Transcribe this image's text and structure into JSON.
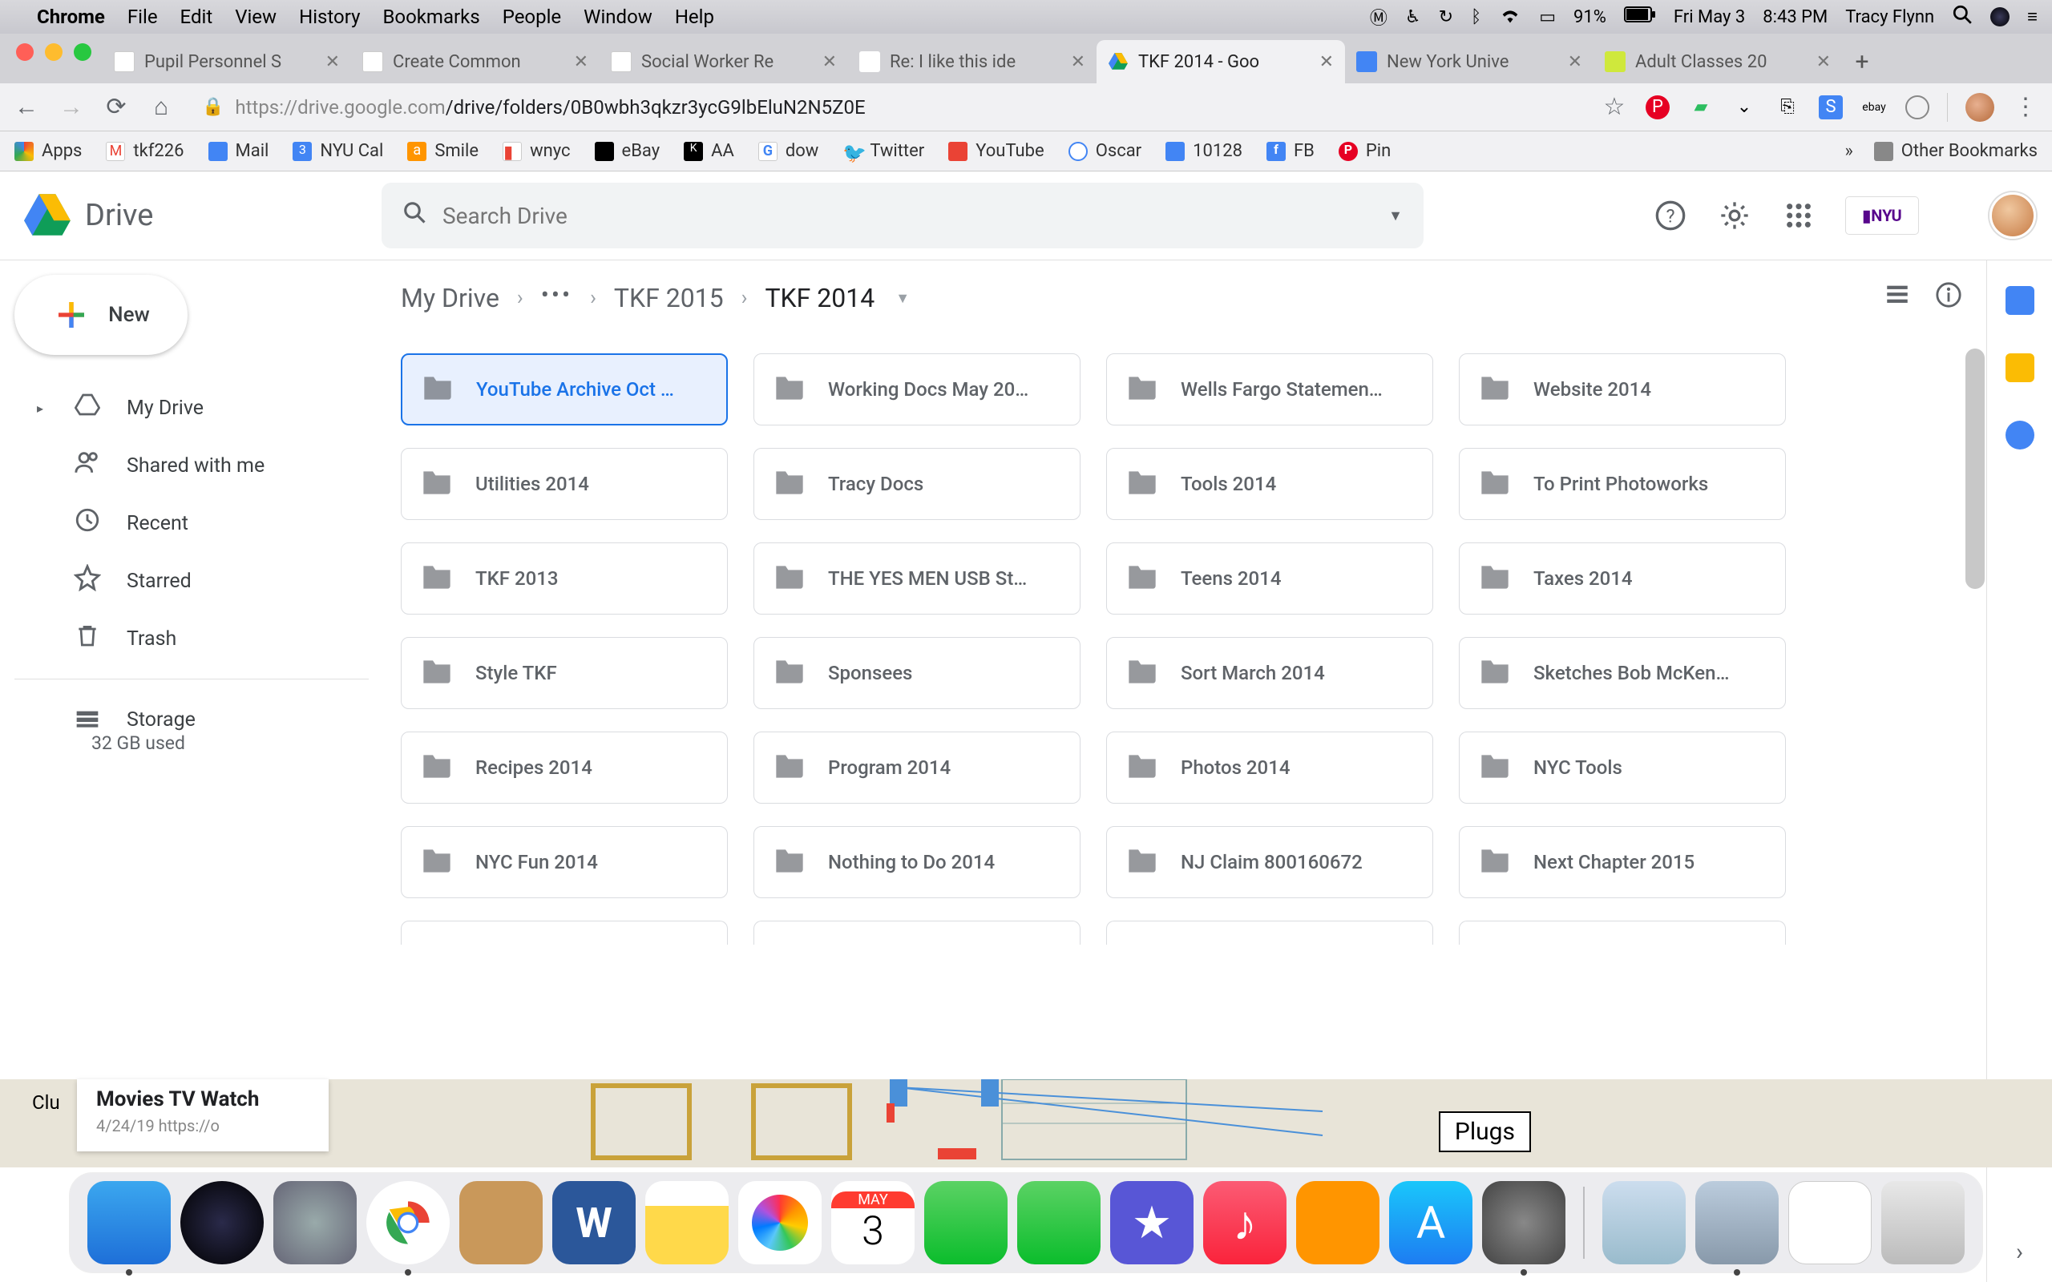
{
  "menubar": {
    "app": "Chrome",
    "menus": [
      "File",
      "Edit",
      "View",
      "History",
      "Bookmarks",
      "People",
      "Window",
      "Help"
    ],
    "battery": "91%",
    "date": "Fri May 3",
    "time": "8:43 PM",
    "user": "Tracy Flynn"
  },
  "tabs": [
    {
      "title": "Pupil Personnel S"
    },
    {
      "title": "Create Common"
    },
    {
      "title": "Social Worker Re"
    },
    {
      "title": "Re: I like this ide"
    },
    {
      "title": "TKF 2014 - Goo",
      "active": true
    },
    {
      "title": "New York Unive"
    },
    {
      "title": "Adult Classes 20"
    }
  ],
  "omnibox": {
    "url_host": "https://drive.google.com",
    "url_path": "/drive/folders/0B0wbh3qkzr3ycG9lbEluN2N5Z0E"
  },
  "bookmarks": [
    "Apps",
    "tkf226",
    "Mail",
    "NYU Cal",
    "Smile",
    "wnyc",
    "eBay",
    "AA",
    "dow",
    "Twitter",
    "YouTube",
    "Oscar",
    "10128",
    "FB",
    "Pin"
  ],
  "bookmarks_overflow": "»",
  "bookmarks_other": "Other Bookmarks",
  "drive": {
    "product": "Drive",
    "search_placeholder": "Search Drive",
    "org_badge": "NYU",
    "new_label": "New",
    "nav": {
      "mydrive": "My Drive",
      "shared": "Shared with me",
      "recent": "Recent",
      "starred": "Starred",
      "trash": "Trash",
      "storage": "Storage",
      "storage_used": "32 GB used"
    },
    "breadcrumb": {
      "root": "My Drive",
      "mid": "TKF 2015",
      "current": "TKF 2014"
    },
    "folders": [
      "YouTube Archive Oct …",
      "Working Docs May 20…",
      "Wells Fargo Statemen…",
      "Website 2014",
      "Utilities 2014",
      "Tracy Docs",
      "Tools 2014",
      "To Print Photoworks",
      "TKF 2013",
      "THE YES MEN USB St…",
      "Teens 2014",
      "Taxes 2014",
      "Style TKF",
      "Sponsees",
      "Sort March 2014",
      "Sketches Bob McKen…",
      "Recipes 2014",
      "Program 2014",
      "Photos 2014",
      "NYC Tools",
      "NYC Fun 2014",
      "Nothing to Do 2014",
      "NJ Claim 800160672",
      "Next Chapter 2015"
    ],
    "selected_index": 0
  },
  "below": {
    "card_title": "Movies TV Watch",
    "card_sub": "4/24/19   https://o",
    "plugs": "Plugs"
  },
  "dock": [
    "finder",
    "siri",
    "launchpad",
    "chrome",
    "contacts",
    "word",
    "notes",
    "photos",
    "calendar",
    "messages",
    "facetime",
    "imovie",
    "music",
    "books",
    "appstore",
    "settings",
    "sep",
    "scanner",
    "preview",
    "textedit",
    "trash"
  ]
}
